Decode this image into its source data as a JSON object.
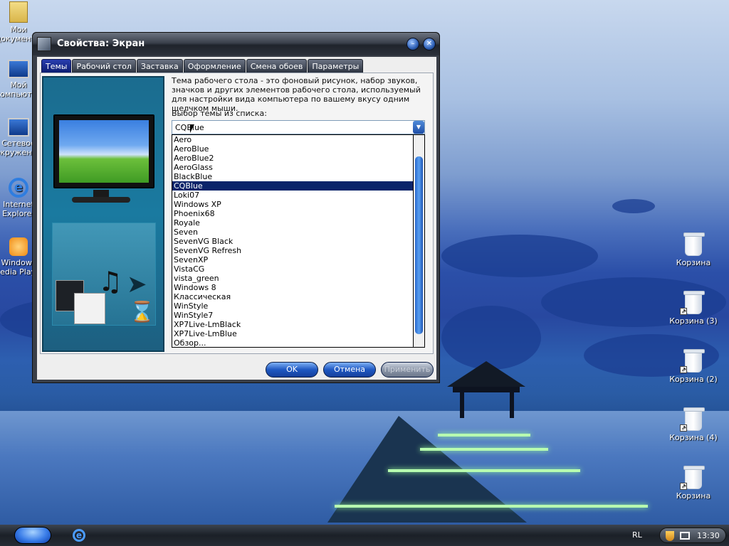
{
  "window": {
    "title": "Свойства: Экран",
    "minimize_label": "–",
    "close_label": "✕"
  },
  "tabs": [
    {
      "label": "Темы",
      "active": true
    },
    {
      "label": "Рабочий стол"
    },
    {
      "label": "Заставка"
    },
    {
      "label": "Оформление"
    },
    {
      "label": "Смена обоев"
    },
    {
      "label": "Параметры"
    }
  ],
  "themes_page": {
    "description": "Тема рабочего стола - это фоновый рисунок, набор звуков, значков и других элементов рабочего стола, используемый для настройки вида компьютера по вашему вкусу одним щелчком мыши.",
    "select_label": "Выбор темы из списка:",
    "selected_theme": "CQBlue",
    "theme_list": [
      "Aero",
      "AeroBlue",
      "AeroBlue2",
      "AeroGlass",
      "BlackBlue",
      "CQBlue",
      "Loki07",
      "Windows XP",
      "Phoenix68",
      "Royale",
      "Seven",
      "SevenVG Black",
      "SevenVG Refresh",
      "SevenXP",
      "VistaCG",
      "vista_green",
      "Windows 8",
      "Классическая",
      "WinStyle",
      "WinStyle7",
      "XP7Live-LmBlack",
      "XP7Live-LmBlue",
      "Обзор..."
    ]
  },
  "buttons": {
    "ok": "OK",
    "cancel": "Отмена",
    "apply": "Применить"
  },
  "desktop_icons_left": [
    {
      "label": "Мои документы",
      "icon": "folder-icon"
    },
    {
      "label": "Мой компьютер",
      "icon": "computer-icon"
    },
    {
      "label": "Сетевое окружение",
      "icon": "network-icon"
    },
    {
      "label": "Internet Explorer",
      "icon": "ie-icon"
    },
    {
      "label": "Windows Media Player",
      "icon": "media-player-icon"
    }
  ],
  "desktop_icons_right": [
    {
      "label": "Корзина"
    },
    {
      "label": "Корзина (3)"
    },
    {
      "label": "Корзина (2)"
    },
    {
      "label": "Корзина (4)"
    },
    {
      "label": "Корзина"
    }
  ],
  "taskbar": {
    "language": "RL",
    "clock": "13:30"
  },
  "colors": {
    "tab_active": "#1a2f96",
    "selection": "#0a246a",
    "button_blue": "#1f58c2"
  }
}
